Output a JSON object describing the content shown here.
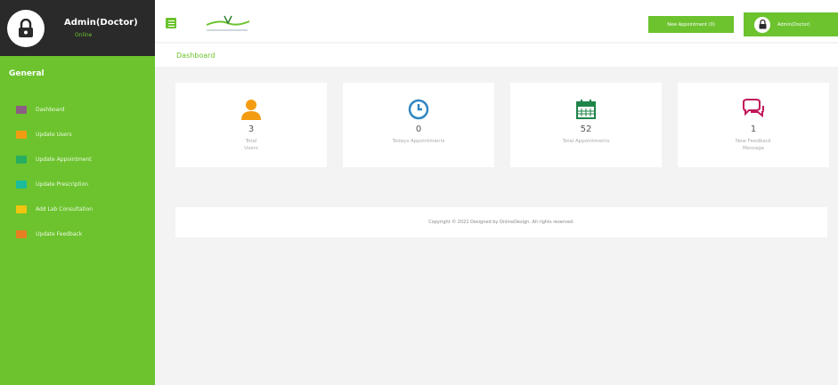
{
  "profile": {
    "name": "Admin(Doctor)",
    "status": "Online",
    "status_color": "#6cc32e"
  },
  "sidebar": {
    "section_title": "General",
    "items": [
      {
        "label": "Dashboard",
        "icon": "dashboard-icon",
        "color": "#8b5e83"
      },
      {
        "label": "Update Users",
        "icon": "users-icon",
        "color": "#f39c12"
      },
      {
        "label": "Update Appointment",
        "icon": "calendar-icon",
        "color": "#27ae60"
      },
      {
        "label": "Update Prescription",
        "icon": "prescription-icon",
        "color": "#1abc9c"
      },
      {
        "label": "Add Lab Consultation",
        "icon": "lab-icon",
        "color": "#f1c40f"
      },
      {
        "label": "Update Feedback",
        "icon": "feedback-icon",
        "color": "#e67e22"
      }
    ]
  },
  "topbar": {
    "appointment_button": "New Appointment (0)",
    "user_button": "Admin(Doctor)"
  },
  "breadcrumb": {
    "title": "Dashboard"
  },
  "cards": [
    {
      "icon": "user-icon",
      "count": "3",
      "label_line1": "Total",
      "label_line2": "Users",
      "color": "#f39c12"
    },
    {
      "icon": "clock-icon",
      "count": "0",
      "label_line1": "Todays Appointments",
      "label_line2": "",
      "color": "#2e86c1"
    },
    {
      "icon": "calendar-icon",
      "count": "52",
      "label_line1": "Total Appointments",
      "label_line2": "",
      "color": "#1e8449"
    },
    {
      "icon": "chat-icon",
      "count": "1",
      "label_line1": "New Feedback",
      "label_line2": "Message",
      "color": "#c2185b"
    }
  ],
  "footer": {
    "text": "Copyright © 2021 Designed by OnlineDesign. All rights reserved."
  },
  "colors": {
    "accent": "#6cc32e",
    "profile_bg": "#2a2a2a",
    "page_bg": "#f3f3f3"
  }
}
